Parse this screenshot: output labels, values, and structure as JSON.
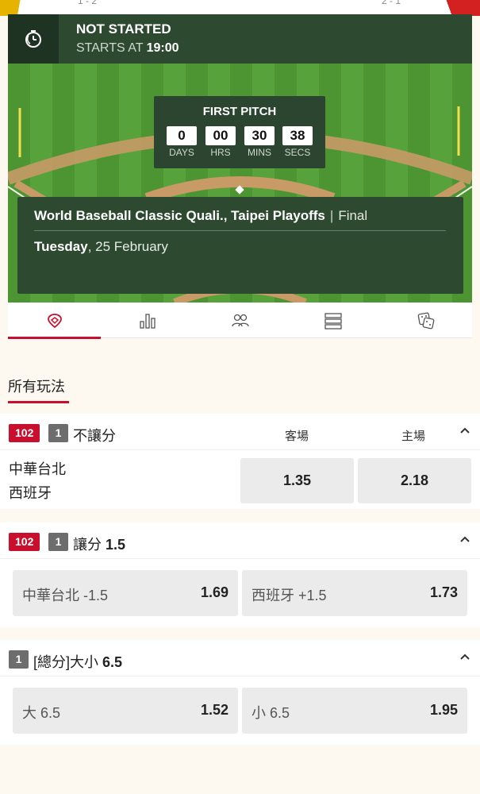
{
  "top_strip": {
    "score_left": "1 - 2",
    "score_right": "2 - 1"
  },
  "status": {
    "title": "NOT STARTED",
    "starts_prefix": "STARTS AT",
    "starts_time": "19:00",
    "icon": "stopwatch-icon"
  },
  "countdown": {
    "title": "FIRST PITCH",
    "units": [
      {
        "value": "0",
        "label": "DAYS"
      },
      {
        "value": "00",
        "label": "HRS"
      },
      {
        "value": "30",
        "label": "MINS"
      },
      {
        "value": "38",
        "label": "SECS"
      }
    ]
  },
  "match": {
    "competition": "World Baseball Classic Quali., Taipei Playoffs",
    "separator": "|",
    "stage": "Final",
    "weekday": "Tuesday",
    "date": ", 25 February"
  },
  "tabs": [
    {
      "name": "pitch-tab",
      "icon": "pin-icon",
      "active": true
    },
    {
      "name": "stats-tab",
      "icon": "bar-chart-icon",
      "active": false
    },
    {
      "name": "lineups-tab",
      "icon": "players-icon",
      "active": false
    },
    {
      "name": "standings-tab",
      "icon": "list-icon",
      "active": false
    },
    {
      "name": "bet-builder-tab",
      "icon": "dice-icon",
      "active": false
    }
  ],
  "section": {
    "title": "所有玩法"
  },
  "markets": {
    "moneyline": {
      "code": "102",
      "count": "1",
      "title": "不讓分",
      "col_away": "客場",
      "col_home": "主場",
      "team_a": "中華台北",
      "team_b": "西班牙",
      "odd_away": "1.35",
      "odd_home": "2.18"
    },
    "handicap": {
      "code": "102",
      "count": "1",
      "title_prefix": "讓分 ",
      "title_line": "1.5",
      "left_label": "中華台北 -1.5",
      "left_odd": "1.69",
      "right_label": "西班牙 +1.5",
      "right_odd": "1.73"
    },
    "total": {
      "count": "1",
      "title_prefix": "[總分]大小 ",
      "title_line": "6.5",
      "left_label": "大 6.5",
      "left_odd": "1.52",
      "right_label": "小 6.5",
      "right_odd": "1.95"
    }
  },
  "colors": {
    "accent_red": "#c8102e",
    "panel_green": "#2d4a31",
    "grass": "#5aa83c"
  }
}
